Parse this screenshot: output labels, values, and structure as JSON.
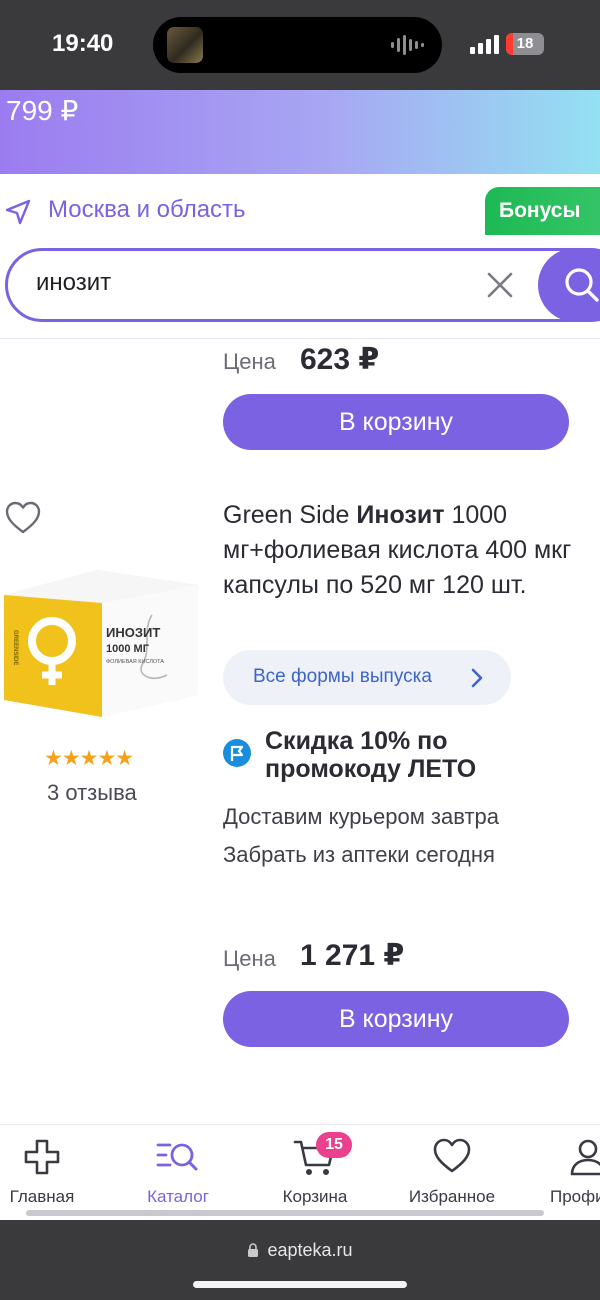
{
  "status_bar": {
    "time": "19:40",
    "battery": "18",
    "battery_level_percent": 18
  },
  "banner": {
    "price": "799 ₽"
  },
  "location": {
    "label": "Москва и область"
  },
  "bonus": {
    "label": "Бонусы"
  },
  "search": {
    "value": "инозит"
  },
  "previous_item": {
    "price_label": "Цена",
    "price": "623 ₽",
    "cart_label": "В корзину"
  },
  "product": {
    "brand": "Green Side",
    "name_bold": "Инозит",
    "title_rest": "1000 мг+фолиевая кислота 400 мкг капсулы по 520 мг 120 шт.",
    "rating": 5,
    "stars": "★★★★★",
    "reviews": "3 отзыва",
    "forms_label": "Все формы выпуска",
    "promo": "Скидка 10% по промокоду ЛЕТО",
    "delivery": "Доставим курьером завтра",
    "pickup": "Забрать из аптеки сегодня",
    "price_label": "Цена",
    "price": "1 271 ₽",
    "cart_label": "В корзину",
    "image": {
      "title": "ИНОЗИТ",
      "dose": "1000 МГ",
      "subtitle": "ФОЛИЕВАЯ КИСЛОТА",
      "brand": "GREENSIDE"
    }
  },
  "bottom_nav": {
    "items": [
      {
        "label": "Главная",
        "icon": "plus-cross-icon"
      },
      {
        "label": "Каталог",
        "icon": "catalog-search-icon"
      },
      {
        "label": "Корзина",
        "icon": "cart-icon"
      },
      {
        "label": "Избранное",
        "icon": "heart-icon"
      },
      {
        "label": "Профиль",
        "icon": "user-icon"
      }
    ],
    "active": "Каталог",
    "cart_count": "15"
  },
  "browser": {
    "url": "eapteka.ru"
  },
  "colors": {
    "accent": "#7b62e3",
    "bonus_green": "#1db954",
    "badge_pink": "#ec3f8e",
    "star": "#f4a21b",
    "link_blue": "#3d64c6"
  }
}
